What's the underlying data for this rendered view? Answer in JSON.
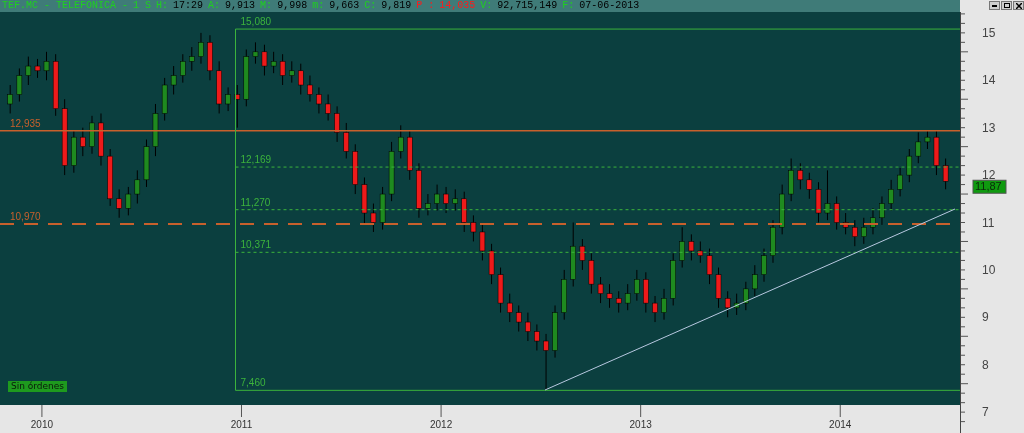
{
  "header": {
    "symbol": "TEF.MC - TELEFONICA -",
    "interval": "1 S",
    "fields": [
      {
        "label": "H:",
        "value": "17:29",
        "highlight": false
      },
      {
        "label": "A:",
        "value": "9,913",
        "highlight": false
      },
      {
        "label": "M:",
        "value": "9,998",
        "highlight": false
      },
      {
        "label": "m:",
        "value": "9,663",
        "highlight": false
      },
      {
        "label": "C:",
        "value": "9,819",
        "highlight": false
      },
      {
        "label": "P :",
        "value": "14,035",
        "highlight": true
      },
      {
        "label": "V:",
        "value": "92,715,149",
        "highlight": false
      },
      {
        "label": "F:",
        "value": "07-06-2013",
        "highlight": false
      }
    ]
  },
  "chart": {
    "status": "Sin órdenes",
    "last_price": "11,87",
    "chart_data": {
      "type": "candlestick",
      "x": [
        2009.841,
        2009.887,
        2009.932,
        2009.978,
        2010.023,
        2010.069,
        2010.114,
        2010.16,
        2010.205,
        2010.251,
        2010.296,
        2010.342,
        2010.387,
        2010.433,
        2010.478,
        2010.524,
        2010.569,
        2010.615,
        2010.66,
        2010.706,
        2010.751,
        2010.797,
        2010.842,
        2010.888,
        2010.933,
        2010.979,
        2011.024,
        2011.07,
        2011.115,
        2011.161,
        2011.206,
        2011.252,
        2011.297,
        2011.343,
        2011.388,
        2011.434,
        2011.479,
        2011.525,
        2011.57,
        2011.616,
        2011.661,
        2011.707,
        2011.752,
        2011.798,
        2011.843,
        2011.889,
        2011.934,
        2011.98,
        2012.025,
        2012.071,
        2012.116,
        2012.162,
        2012.207,
        2012.253,
        2012.298,
        2012.344,
        2012.389,
        2012.435,
        2012.48,
        2012.526,
        2012.571,
        2012.617,
        2012.662,
        2012.708,
        2012.753,
        2012.799,
        2012.844,
        2012.89,
        2012.935,
        2012.981,
        2013.026,
        2013.072,
        2013.117,
        2013.163,
        2013.208,
        2013.254,
        2013.299,
        2013.345,
        2013.39,
        2013.436,
        2013.481,
        2013.527,
        2013.572,
        2013.618,
        2013.663,
        2013.709,
        2013.754,
        2013.8,
        2013.845,
        2013.891,
        2013.936,
        2013.982,
        2014.027,
        2014.073,
        2014.118,
        2014.164,
        2014.209,
        2014.255,
        2014.3,
        2014.346,
        2014.391,
        2014.437,
        2014.482,
        2014.528
      ],
      "ohlc": [
        [
          13.5,
          13.9,
          13.3,
          13.7
        ],
        [
          13.7,
          14.25,
          13.55,
          14.1
        ],
        [
          14.1,
          14.5,
          13.9,
          14.3
        ],
        [
          14.3,
          14.45,
          14.05,
          14.2
        ],
        [
          14.2,
          14.6,
          14.0,
          14.4
        ],
        [
          14.4,
          14.55,
          13.25,
          13.4
        ],
        [
          13.4,
          13.6,
          12.0,
          12.2
        ],
        [
          12.2,
          12.95,
          12.05,
          12.8
        ],
        [
          12.8,
          13.0,
          12.4,
          12.6
        ],
        [
          12.6,
          13.25,
          12.45,
          13.1
        ],
        [
          13.1,
          13.3,
          12.2,
          12.4
        ],
        [
          12.4,
          12.55,
          11.35,
          11.5
        ],
        [
          11.5,
          11.7,
          11.1,
          11.3
        ],
        [
          11.3,
          11.75,
          11.15,
          11.6
        ],
        [
          11.6,
          12.1,
          11.4,
          11.9
        ],
        [
          11.9,
          12.75,
          11.75,
          12.6
        ],
        [
          12.6,
          13.5,
          12.4,
          13.3
        ],
        [
          13.3,
          14.05,
          13.15,
          13.9
        ],
        [
          13.9,
          14.3,
          13.7,
          14.1
        ],
        [
          14.1,
          14.55,
          13.95,
          14.4
        ],
        [
          14.4,
          14.7,
          14.2,
          14.5
        ],
        [
          14.5,
          15.0,
          14.35,
          14.8
        ],
        [
          14.8,
          14.95,
          14.0,
          14.2
        ],
        [
          14.2,
          14.4,
          13.3,
          13.5
        ],
        [
          13.5,
          13.85,
          13.35,
          13.7
        ],
        [
          13.7,
          13.9,
          13.0,
          13.6
        ],
        [
          13.6,
          14.65,
          13.45,
          14.5
        ],
        [
          14.5,
          14.8,
          14.35,
          14.6
        ],
        [
          14.6,
          14.75,
          14.1,
          14.3
        ],
        [
          14.3,
          14.6,
          14.15,
          14.4
        ],
        [
          14.4,
          14.55,
          13.9,
          14.1
        ],
        [
          14.1,
          14.4,
          13.95,
          14.2
        ],
        [
          14.2,
          14.35,
          13.7,
          13.9
        ],
        [
          13.9,
          14.1,
          13.55,
          13.7
        ],
        [
          13.7,
          13.85,
          13.3,
          13.5
        ],
        [
          13.5,
          13.7,
          13.15,
          13.3
        ],
        [
          13.3,
          13.45,
          12.7,
          12.9
        ],
        [
          12.9,
          13.1,
          12.35,
          12.5
        ],
        [
          12.5,
          12.65,
          11.6,
          11.8
        ],
        [
          11.8,
          11.95,
          10.95,
          11.2
        ],
        [
          11.2,
          11.4,
          10.8,
          11.0
        ],
        [
          11.0,
          11.75,
          10.85,
          11.6
        ],
        [
          11.6,
          12.7,
          11.45,
          12.5
        ],
        [
          12.5,
          13.05,
          12.35,
          12.8
        ],
        [
          12.8,
          12.95,
          11.9,
          12.1
        ],
        [
          12.1,
          12.25,
          11.1,
          11.3
        ],
        [
          11.3,
          11.6,
          11.15,
          11.4
        ],
        [
          11.4,
          11.8,
          11.25,
          11.6
        ],
        [
          11.6,
          11.75,
          11.2,
          11.4
        ],
        [
          11.4,
          11.7,
          11.25,
          11.5
        ],
        [
          11.5,
          11.65,
          10.8,
          11.0
        ],
        [
          11.0,
          11.15,
          10.6,
          10.8
        ],
        [
          10.8,
          10.95,
          10.2,
          10.4
        ],
        [
          10.4,
          10.55,
          9.7,
          9.9
        ],
        [
          9.9,
          10.05,
          9.1,
          9.3
        ],
        [
          9.3,
          9.5,
          8.9,
          9.1
        ],
        [
          9.1,
          9.25,
          8.7,
          8.9
        ],
        [
          8.9,
          9.1,
          8.5,
          8.7
        ],
        [
          8.7,
          8.85,
          8.3,
          8.5
        ],
        [
          8.5,
          8.65,
          7.46,
          8.3
        ],
        [
          8.3,
          9.25,
          8.15,
          9.1
        ],
        [
          9.1,
          10.0,
          8.95,
          9.8
        ],
        [
          9.8,
          11.0,
          9.65,
          10.5
        ],
        [
          10.5,
          10.65,
          10.0,
          10.2
        ],
        [
          10.2,
          10.35,
          9.5,
          9.7
        ],
        [
          9.7,
          9.85,
          9.3,
          9.5
        ],
        [
          9.5,
          9.7,
          9.2,
          9.4
        ],
        [
          9.4,
          9.55,
          9.1,
          9.3
        ],
        [
          9.3,
          9.7,
          9.15,
          9.5
        ],
        [
          9.5,
          10.0,
          9.35,
          9.8
        ],
        [
          9.8,
          9.95,
          9.1,
          9.3
        ],
        [
          9.3,
          9.45,
          8.9,
          9.1
        ],
        [
          9.1,
          9.6,
          8.95,
          9.4
        ],
        [
          9.4,
          10.35,
          9.25,
          10.2
        ],
        [
          10.2,
          10.9,
          10.05,
          10.6
        ],
        [
          10.6,
          10.75,
          10.2,
          10.4
        ],
        [
          10.4,
          10.6,
          10.15,
          10.3
        ],
        [
          10.3,
          10.45,
          9.7,
          9.9
        ],
        [
          9.9,
          10.05,
          9.2,
          9.4
        ],
        [
          9.4,
          9.55,
          9.0,
          9.2
        ],
        [
          9.2,
          9.5,
          9.05,
          9.3
        ],
        [
          9.3,
          9.75,
          9.15,
          9.6
        ],
        [
          9.6,
          10.1,
          9.45,
          9.9
        ],
        [
          9.9,
          10.45,
          9.75,
          10.3
        ],
        [
          10.3,
          11.05,
          10.15,
          10.9
        ],
        [
          10.9,
          11.8,
          10.75,
          11.6
        ],
        [
          11.6,
          12.35,
          11.45,
          12.1
        ],
        [
          12.1,
          12.25,
          11.7,
          11.9
        ],
        [
          11.9,
          12.05,
          11.5,
          11.7
        ],
        [
          11.7,
          11.85,
          11.0,
          11.2
        ],
        [
          11.2,
          12.1,
          11.05,
          11.4
        ],
        [
          11.4,
          11.55,
          10.85,
          11.0
        ],
        [
          11.0,
          11.2,
          10.75,
          10.9
        ],
        [
          10.9,
          11.05,
          10.5,
          10.7
        ],
        [
          10.7,
          11.1,
          10.55,
          10.9
        ],
        [
          10.9,
          11.3,
          10.75,
          11.1
        ],
        [
          11.1,
          11.55,
          10.95,
          11.4
        ],
        [
          11.4,
          11.9,
          11.25,
          11.7
        ],
        [
          11.7,
          12.15,
          11.55,
          12.0
        ],
        [
          12.0,
          12.55,
          11.85,
          12.4
        ],
        [
          12.4,
          12.9,
          12.25,
          12.7
        ],
        [
          12.7,
          12.935,
          12.55,
          12.8
        ],
        [
          12.8,
          12.95,
          12.0,
          12.2
        ],
        [
          12.2,
          12.35,
          11.7,
          11.87
        ]
      ],
      "xlim": [
        2009.79,
        2014.6
      ],
      "ylim": [
        6.56,
        15.44
      ],
      "ref_lines": [
        {
          "axis": "y",
          "value": 12.935,
          "label": "12,935",
          "color": "#c8602c"
        },
        {
          "axis": "y",
          "value": 10.97,
          "label": "10,970",
          "color": "#c8602c"
        },
        {
          "axis": "y",
          "value": 15.08,
          "label": "15,080",
          "color": "#3cb33c"
        },
        {
          "axis": "y",
          "value": 12.169,
          "label": "12,169",
          "color": "#3cb33c"
        },
        {
          "axis": "y",
          "value": 11.27,
          "label": "11,270",
          "color": "#3cb33c"
        },
        {
          "axis": "y",
          "value": 10.371,
          "label": "10,371",
          "color": "#3cb33c"
        },
        {
          "axis": "y",
          "value": 7.46,
          "label": "7,460",
          "color": "#3cb33c"
        },
        {
          "axis": "x",
          "value": 2010.97,
          "color": "#3cb33c"
        }
      ],
      "yticks": [
        {
          "value": 15,
          "label": "15"
        },
        {
          "value": 14,
          "label": "14"
        },
        {
          "value": 13,
          "label": "13"
        },
        {
          "value": 12,
          "label": "12"
        },
        {
          "value": 11,
          "label": "11"
        },
        {
          "value": 10,
          "label": "10"
        },
        {
          "value": 9,
          "label": "9"
        },
        {
          "value": 8,
          "label": "8"
        },
        {
          "value": 7,
          "label": "7"
        }
      ],
      "xticks": [
        {
          "value": 2010,
          "label": "2010"
        },
        {
          "value": 2011,
          "label": "2011"
        },
        {
          "value": 2012,
          "label": "2012"
        },
        {
          "value": 2013,
          "label": "2013"
        },
        {
          "value": 2014,
          "label": "2014"
        }
      ]
    }
  }
}
